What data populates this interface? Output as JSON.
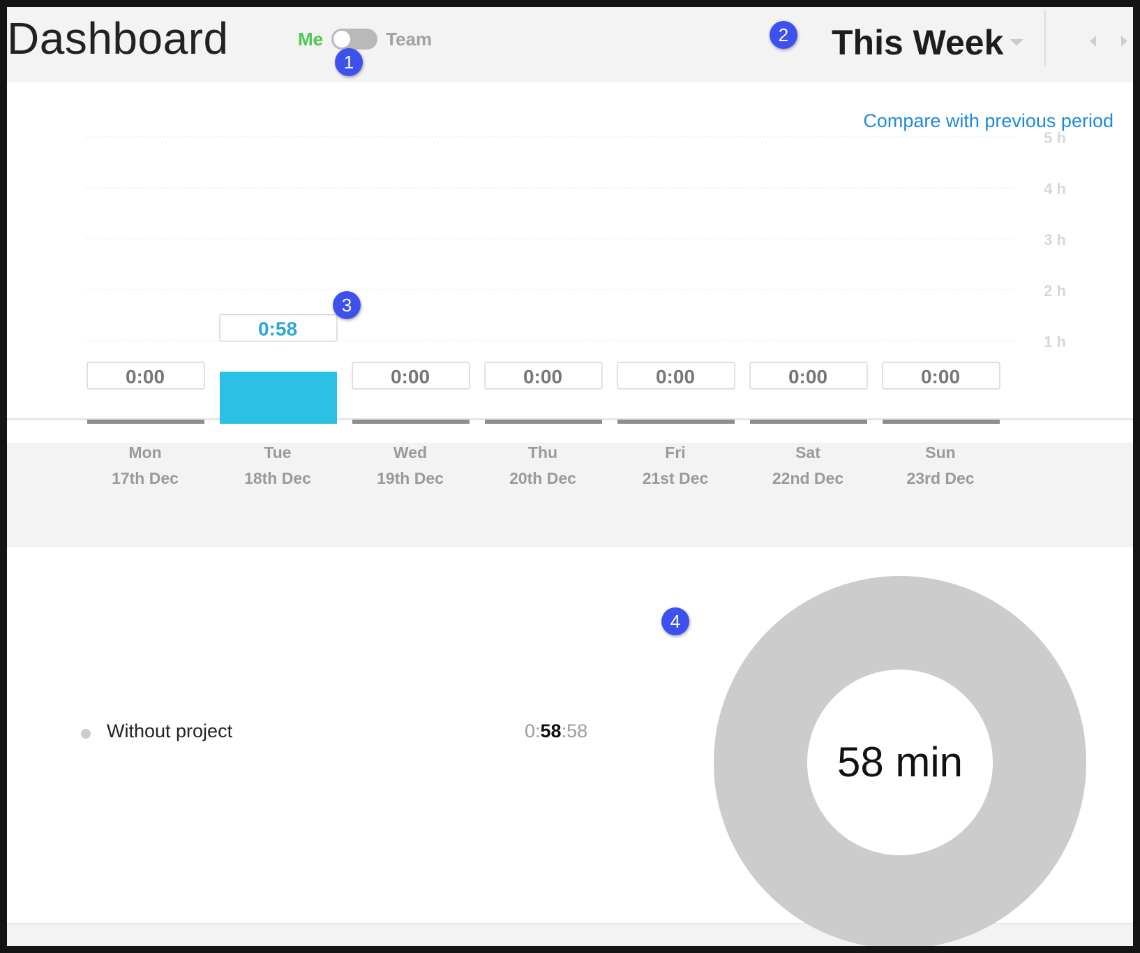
{
  "header": {
    "title": "Dashboard",
    "toggle": {
      "left_label": "Me",
      "right_label": "Team",
      "selected": "Me"
    },
    "period": {
      "label": "This Week"
    },
    "prev_icon": "chevron-left-icon",
    "next_icon": "chevron-right-icon"
  },
  "markers": [
    "1",
    "2",
    "3",
    "4"
  ],
  "compare_link": "Compare with previous period",
  "chart_data": {
    "type": "bar",
    "categories": [
      "Mon",
      "Tue",
      "Wed",
      "Thu",
      "Fri",
      "Sat",
      "Sun"
    ],
    "dates": [
      "17th Dec",
      "18th Dec",
      "19th Dec",
      "20th Dec",
      "21st Dec",
      "22nd Dec",
      "23rd Dec"
    ],
    "highlighted_category": "Wed",
    "values_hours": [
      0,
      0.9667,
      0,
      0,
      0,
      0,
      0
    ],
    "value_labels": [
      "0:00",
      "0:58",
      "0:00",
      "0:00",
      "0:00",
      "0:00",
      "0:00"
    ],
    "y_ticks": [
      "1 h",
      "2 h",
      "3 h",
      "4 h",
      "5 h"
    ],
    "ylim_hours": [
      0,
      5
    ],
    "grid": true,
    "colors": {
      "active": "#2bc0e4",
      "zero": "#8e8e8e",
      "active_label": "#2aa6d9",
      "zero_label": "#777777"
    }
  },
  "summary": {
    "items": [
      {
        "label": "Without project",
        "time_prefix": "0:",
        "time_bold": "58",
        "time_suffix": ":58",
        "color": "#cccccc"
      }
    ],
    "donut": {
      "center_text": "58 min",
      "color": "#cccccc"
    }
  }
}
